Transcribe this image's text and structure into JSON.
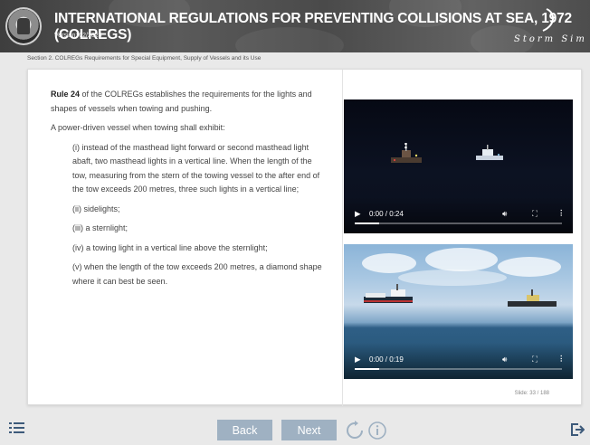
{
  "header": {
    "title": "INTERNATIONAL REGULATIONS FOR PREVENTING COLLISIONS AT SEA, 1972 (COLREGS)",
    "version": "Version: 02/2023",
    "brand": "Storm Sim"
  },
  "breadcrumb": "Section 2. COLREGs Requirements for Special Equipment, Supply of Vessels and its Use",
  "content": {
    "rule_label": "Rule 24",
    "intro_rest": " of the COLREGs establishes the requirements for the lights and shapes of vessels when towing and pushing.",
    "lead": "A power-driven vessel when towing shall exhibit:",
    "items": [
      "(i) instead of the masthead light forward or second masthead light abaft, two masthead lights in a vertical line. When the length of the tow, measuring from the stern of the towing vessel to the after end of the tow exceeds 200 metres, three such lights in a vertical line;",
      "(ii) sidelights;",
      "(iii) a sternlight;",
      "(iv) a towing light in a vertical line above the sternlight;",
      "(v) when the length of the tow exceeds 200 metres, a diamond shape where it can best be seen."
    ]
  },
  "videos": [
    {
      "time": "0:00 / 0:24",
      "progress": 0.0
    },
    {
      "time": "0:00 / 0:19",
      "progress": 0.0
    }
  ],
  "slide_counter": "Slide: 33 / 188",
  "footer": {
    "back_label": "Back",
    "next_label": "Next"
  }
}
